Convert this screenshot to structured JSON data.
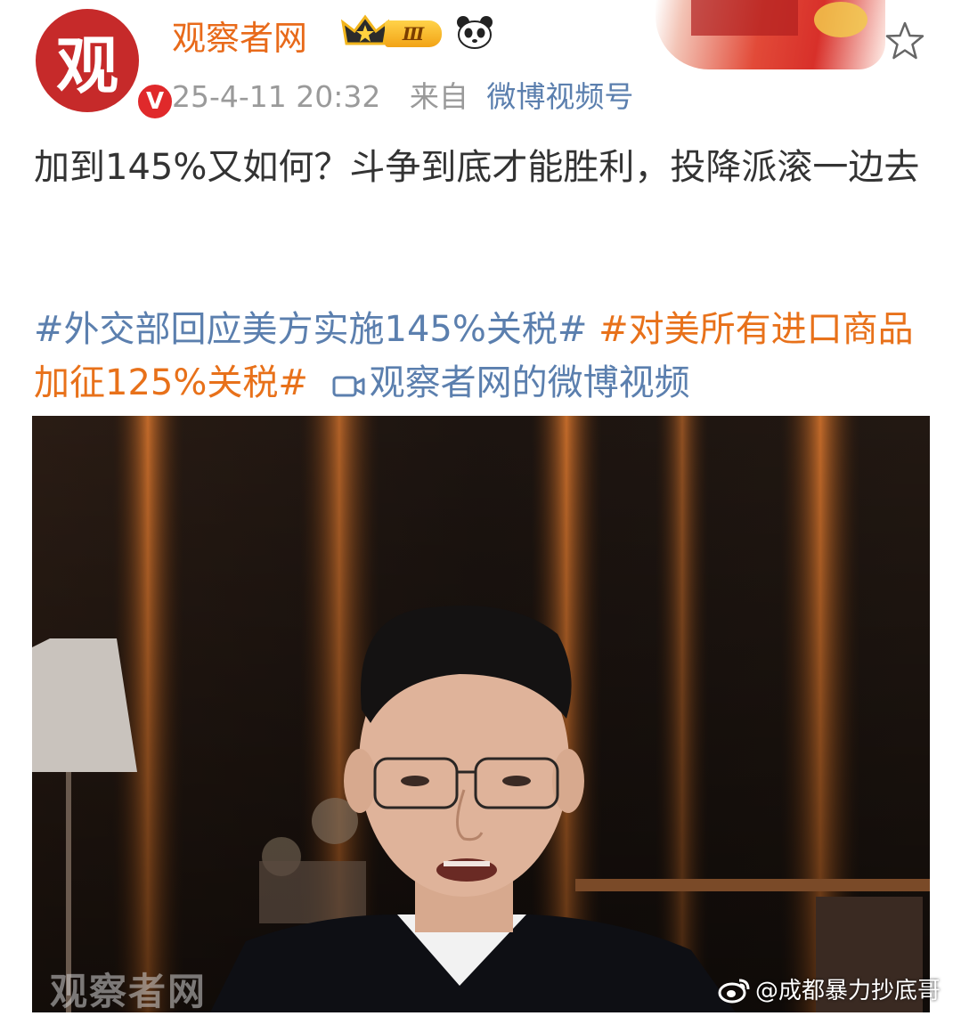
{
  "author": {
    "name": "观察者网",
    "avatar_glyph": "观",
    "verified_badge": "V",
    "level_badge": "Ⅲ",
    "crown_icon": "crown-icon",
    "panda_icon": "panda-icon"
  },
  "meta": {
    "timestamp": "25-4-11 20:32",
    "from_label": "来自",
    "source": "微博视频号"
  },
  "post": {
    "text": "加到145%又如何？斗争到底才能胜利，投降派滚一边去"
  },
  "tags": {
    "tag1": "#外交部回应美方实施145%关税#",
    "tag2": "#对美所有进口商品加征125%关税#",
    "video_link": "观察者网的微博视频"
  },
  "video": {
    "channel_watermark": "观察者网",
    "credit": "@成都暴力抄底哥"
  },
  "colors": {
    "username": "#e86a1a",
    "link_blue": "#5b7fae",
    "tag_orange": "#e8711a",
    "meta_gray": "#9a9a9a",
    "avatar_red": "#c62a2a"
  }
}
